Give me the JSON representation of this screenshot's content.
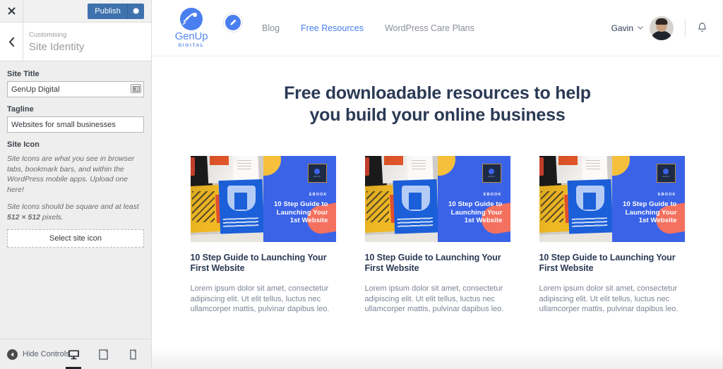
{
  "customizer": {
    "close_icon": "close-x-icon",
    "publish_label": "Publish",
    "gear_icon": "gear-icon",
    "back_icon": "chevron-left-icon",
    "eyebrow": "Customising",
    "panel_title": "Site Identity",
    "site_title": {
      "label": "Site Title",
      "value": "GenUp Digital",
      "field_icon": "autofill-card-icon"
    },
    "tagline": {
      "label": "Tagline",
      "value": "Websites for small businesses"
    },
    "site_icon": {
      "label": "Site Icon",
      "description_1": "Site Icons are what you see in browser tabs, bookmark bars, and within the WordPress mobile apps. Upload one here!",
      "description_2_prefix": "Site Icons should be square and at least ",
      "description_2_bold": "512 × 512",
      "description_2_suffix": " pixels.",
      "button_label": "Select site icon"
    },
    "footer": {
      "hide_controls_label": "Hide Controls",
      "hide_controls_icon": "collapse-circle-icon",
      "devices": [
        {
          "name": "desktop",
          "icon": "desktop-icon",
          "active": true
        },
        {
          "name": "tablet",
          "icon": "tablet-icon",
          "active": false
        },
        {
          "name": "mobile",
          "icon": "mobile-icon",
          "active": false
        }
      ]
    },
    "accent_color": "#3e72ad"
  },
  "preview": {
    "header": {
      "logo_name": "GenUp",
      "logo_sub": "DIGITAL",
      "logo_icon": "comet-logo-icon",
      "edit_badge_icon": "pencil-edit-icon",
      "nav": [
        {
          "label": "Blog",
          "active": false
        },
        {
          "label": "Free Resources",
          "active": true
        },
        {
          "label": "WordPress Care Plans",
          "active": false
        }
      ],
      "user_name": "Gavin",
      "chevron_icon": "chevron-down-icon",
      "avatar_icon": "user-avatar",
      "bell_icon": "bell-notification-icon",
      "nav_active_color": "#4a7ff0"
    },
    "hero": {
      "line1": "Free downloadable resources to help",
      "line2": "you build your online business",
      "color": "#2b3a55"
    },
    "cards": [
      {
        "image": {
          "ebook_label": "EBOOK",
          "cover_title": "10 Step Guide to Launching Your 1st Website",
          "badge_text": "GENUP",
          "blue": "#3b63e8",
          "yellow": "#f6c03c",
          "coral": "#f4705f"
        },
        "title": "10 Step Guide to Launching Your First Website",
        "body": "Lorem ipsum dolor sit amet, consectetur adipiscing elit. Ut elit tellus, luctus nec ullamcorper mattis, pulvinar dapibus leo."
      },
      {
        "image": {
          "ebook_label": "EBOOK",
          "cover_title": "10 Step Guide to Launching Your 1st Website",
          "badge_text": "GENUP",
          "blue": "#3b63e8",
          "yellow": "#f6c03c",
          "coral": "#f4705f"
        },
        "title": "10 Step Guide to Launching Your First Website",
        "body": "Lorem ipsum dolor sit amet, consectetur adipiscing elit. Ut elit tellus, luctus nec ullamcorper mattis, pulvinar dapibus leo."
      },
      {
        "image": {
          "ebook_label": "EBOOK",
          "cover_title": "10 Step Guide to Launching Your 1st Website",
          "badge_text": "GENUP",
          "blue": "#3b63e8",
          "yellow": "#f6c03c",
          "coral": "#f4705f"
        },
        "title": "10 Step Guide to Launching Your First Website",
        "body": "Lorem ipsum dolor sit amet, consectetur adipiscing elit. Ut elit tellus, luctus nec ullamcorper mattis, pulvinar dapibus leo."
      }
    ]
  }
}
